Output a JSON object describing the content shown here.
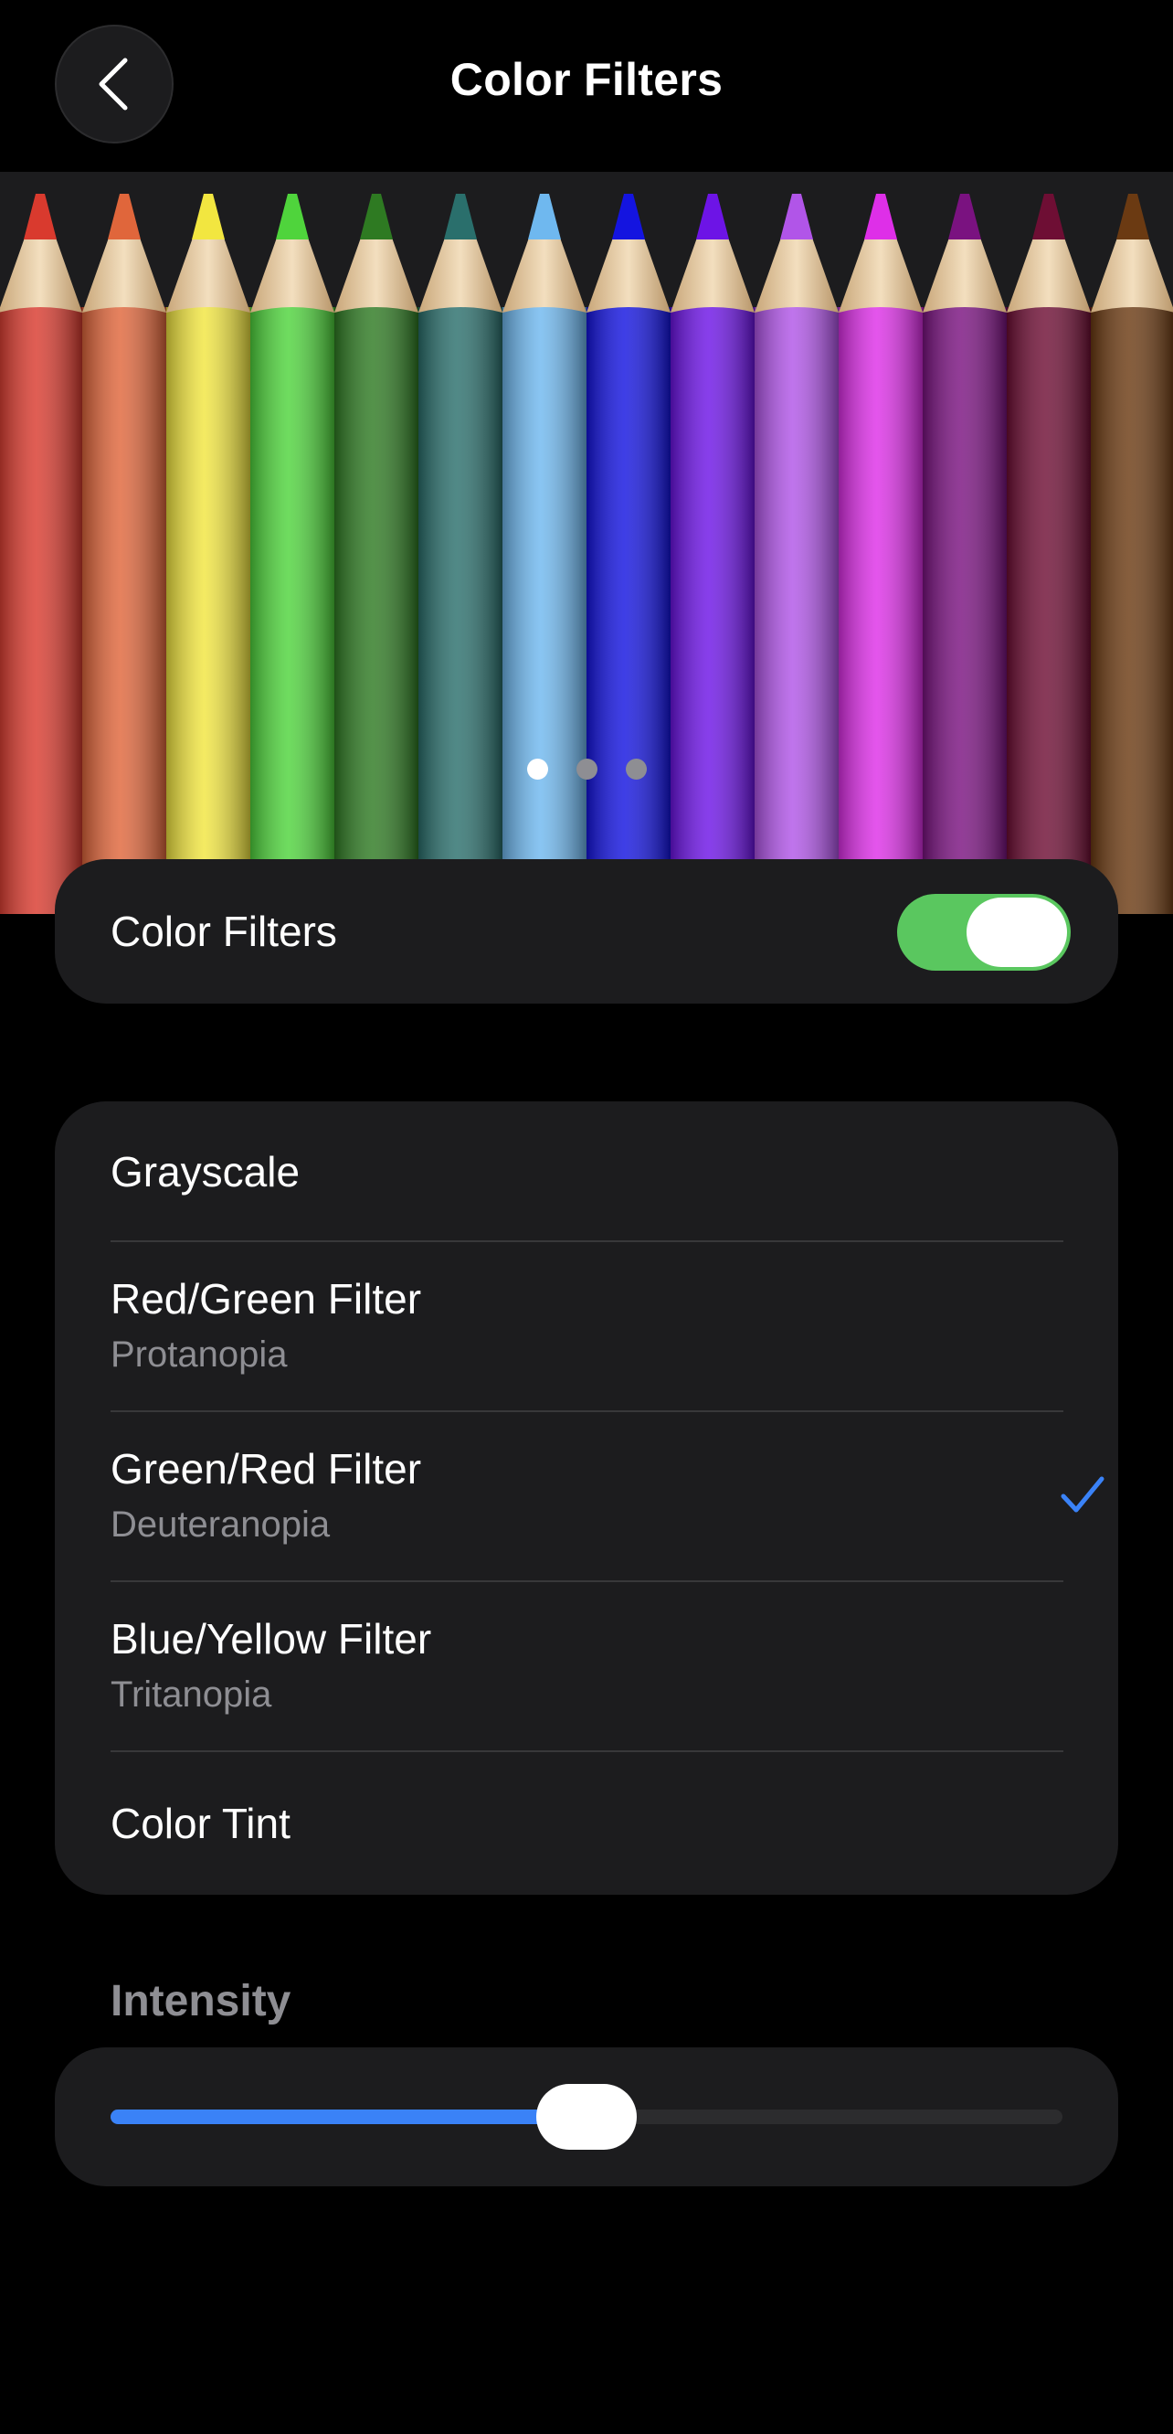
{
  "nav": {
    "title": "Color Filters",
    "back_icon": "chevron-left-icon"
  },
  "banner": {
    "illustration": "colored-pencils",
    "pencil_colors": [
      "#d93a2e",
      "#e0663b",
      "#f2e640",
      "#4fd43c",
      "#2e7a22",
      "#2a6f6c",
      "#6fb8ef",
      "#1414e0",
      "#6d14e6",
      "#b155e8",
      "#de2fe8",
      "#7a1280",
      "#6e0e34",
      "#6b3a12"
    ],
    "page_dots": 3,
    "active_page": 0
  },
  "toggle": {
    "label": "Color Filters",
    "on": true
  },
  "filters": [
    {
      "title": "Grayscale",
      "subtitle": "",
      "selected": false
    },
    {
      "title": "Red/Green Filter",
      "subtitle": "Protanopia",
      "selected": false
    },
    {
      "title": "Green/Red Filter",
      "subtitle": "Deuteranopia",
      "selected": true
    },
    {
      "title": "Blue/Yellow Filter",
      "subtitle": "Tritanopia",
      "selected": false
    },
    {
      "title": "Color Tint",
      "subtitle": "",
      "selected": false
    }
  ],
  "intensity": {
    "header": "Intensity",
    "value": 0.5
  },
  "colors": {
    "background": "#000000",
    "card": "#1c1c1e",
    "toggle_on": "#5ac75f",
    "accent": "#3a82f7",
    "secondary_text": "#8e8e93"
  }
}
